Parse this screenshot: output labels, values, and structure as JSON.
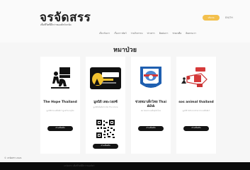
{
  "header": {
    "title": "จรจัดสรร",
    "subtitle": "เพื่อชีวิตที่ดีกว่าของสัตว์จรจัด",
    "donate_label": "บริจาค",
    "lang_label": "EN/TH",
    "nav": [
      "เกี่ยวกับเรา",
      "เรื่องราวสัตว์",
      "ร่วมกิจกรรม",
      "ข่าวสาร",
      "ติดต่อเรา",
      "ช่วยเหลือ",
      "ติดตามเรา"
    ]
  },
  "main": {
    "section_title": "หมาป่วย",
    "cards": [
      {
        "name": "The Hope Thailand",
        "sub": "มูลนิธิช่วยเหลือสัตว์ ดูแลรักษาสุนัข",
        "button": "อ่านเพิ่มเติม"
      },
      {
        "name": "มูลนิธิ เดอะวอยซ์",
        "sub": "มูลนิธิเพื่อสัตว์จรจัด The Voice",
        "button": "อ่านเพิ่มเติม"
      },
      {
        "name": "ช่วยหมาเด็กไทย Thai ADA",
        "sub": "สมาคมช่วยเหลือสุนัขไทย",
        "button": "อ่านเพิ่มเติม"
      },
      {
        "name": "sos animal thailand",
        "sub": "มูลนิธิ SOS Animal ช่วยเหลือสัตว์",
        "button": "อ่านเพิ่มเติม"
      }
    ]
  },
  "footer": {
    "copyright": "© จรจัดสรร 2021",
    "text": "จรจัดสรร เพื่อชีวิตที่ดีกว่าของสัตว์"
  },
  "colors": {
    "accent": "#f3c04d",
    "button_dark": "#141414",
    "footer": "#0c0c0c"
  }
}
